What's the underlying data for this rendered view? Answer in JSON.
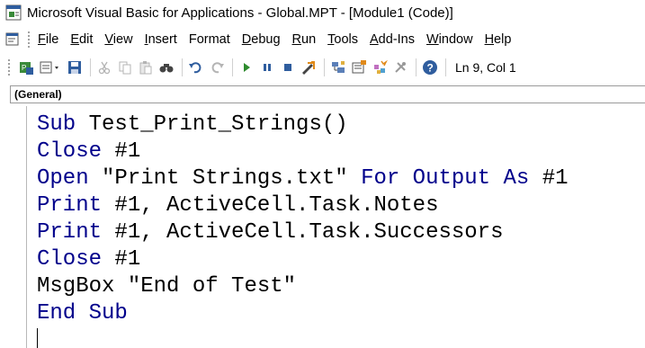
{
  "window": {
    "title": "Microsoft Visual Basic for Applications - Global.MPT - [Module1 (Code)]",
    "app_icon": "vba-app-icon"
  },
  "menubar": {
    "items": [
      {
        "mnemonic": "F",
        "rest": "ile"
      },
      {
        "mnemonic": "E",
        "rest": "dit"
      },
      {
        "mnemonic": "V",
        "rest": "iew"
      },
      {
        "mnemonic": "I",
        "rest": "nsert"
      },
      {
        "mnemonic": "",
        "rest": "Format"
      },
      {
        "mnemonic": "D",
        "rest": "ebug"
      },
      {
        "mnemonic": "R",
        "rest": "un"
      },
      {
        "mnemonic": "T",
        "rest": "ools"
      },
      {
        "mnemonic": "A",
        "rest": "dd-Ins"
      },
      {
        "mnemonic": "W",
        "rest": "indow"
      },
      {
        "mnemonic": "H",
        "rest": "elp"
      }
    ]
  },
  "toolbar": {
    "status": "Ln 9, Col 1",
    "icons": [
      "view-host-app-icon",
      "insert-module-icon",
      "save-icon",
      "cut-icon",
      "copy-icon",
      "paste-icon",
      "find-icon",
      "undo-icon",
      "redo-icon",
      "run-icon",
      "break-icon",
      "reset-icon",
      "design-mode-icon",
      "project-explorer-icon",
      "properties-icon",
      "object-browser-icon",
      "toolbox-icon",
      "help-icon"
    ]
  },
  "object_combo": {
    "value": "(General)"
  },
  "code": {
    "lines": [
      [
        {
          "t": "Sub",
          "k": true
        },
        {
          "t": " Test_Print_Strings()",
          "k": false
        }
      ],
      [
        {
          "t": "Close",
          "k": true
        },
        {
          "t": " #1",
          "k": false
        }
      ],
      [
        {
          "t": "Open",
          "k": true
        },
        {
          "t": " \"Print Strings.txt\" ",
          "k": false
        },
        {
          "t": "For Output As",
          "k": true
        },
        {
          "t": " #1",
          "k": false
        }
      ],
      [
        {
          "t": "Print",
          "k": true
        },
        {
          "t": " #1, ActiveCell.Task.Notes",
          "k": false
        }
      ],
      [
        {
          "t": "Print",
          "k": true
        },
        {
          "t": " #1, ActiveCell.Task.Successors",
          "k": false
        }
      ],
      [
        {
          "t": "Close",
          "k": true
        },
        {
          "t": " #1",
          "k": false
        }
      ],
      [
        {
          "t": "MsgBox \"End of Test\"",
          "k": false
        }
      ],
      [
        {
          "t": "End Sub",
          "k": true
        }
      ]
    ]
  },
  "colors": {
    "keyword": "#00008b",
    "text": "#000000"
  }
}
